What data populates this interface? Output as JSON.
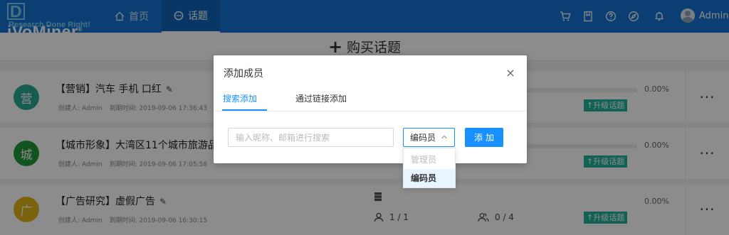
{
  "brand": {
    "logo_first": "D",
    "logo_rest": "iVoMiner",
    "logo_mark": "®",
    "tagline": "Research Done Right!"
  },
  "nav": {
    "home": "首页",
    "topics": "话题"
  },
  "user": {
    "name": "Admin"
  },
  "buy": {
    "plus": "+",
    "label": "购买话题"
  },
  "topics": [
    {
      "badge": "营",
      "badge_color": "#2aa88e",
      "title": "【营销】汽车 手机 口红",
      "creator": "创建人: Admin",
      "expires": "到期时间: 2019-09-06 17:36:43",
      "percent": "0.00%",
      "upgrade": "↑升级话题"
    },
    {
      "badge": "城",
      "badge_color": "#1f9a3a",
      "title": "【城市形象】大湾区11个城市旅游品",
      "creator": "创建人: Admin",
      "expires": "到期时间: 2019-09-06 17:05:58",
      "percent": "0.00%",
      "upgrade": "↑升级话题"
    },
    {
      "badge": "广",
      "badge_color": "#e0b418",
      "title": "【广告研究】虚假广告",
      "creator": "创建人: Admin",
      "expires": "到期时间: 2019-09-06 16:30:15",
      "percent": "0.00%",
      "upgrade": "↑升级话题",
      "members": "1 / 1",
      "coders": "0 / 4"
    }
  ],
  "more": "···",
  "modal": {
    "title": "添加成员",
    "close": "×",
    "tabs": [
      "搜索添加",
      "通过链接添加"
    ],
    "search_placeholder": "输入昵称、邮箱进行搜索",
    "selected_role": "编码员",
    "add_button": "添加"
  },
  "role_options": [
    {
      "label": "管理员",
      "state": "disabled"
    },
    {
      "label": "编码员",
      "state": "selected"
    }
  ],
  "colors": {
    "nav_bg": "#1474d2",
    "accent": "#1890ff",
    "upgrade_bg": "#22b39a"
  }
}
